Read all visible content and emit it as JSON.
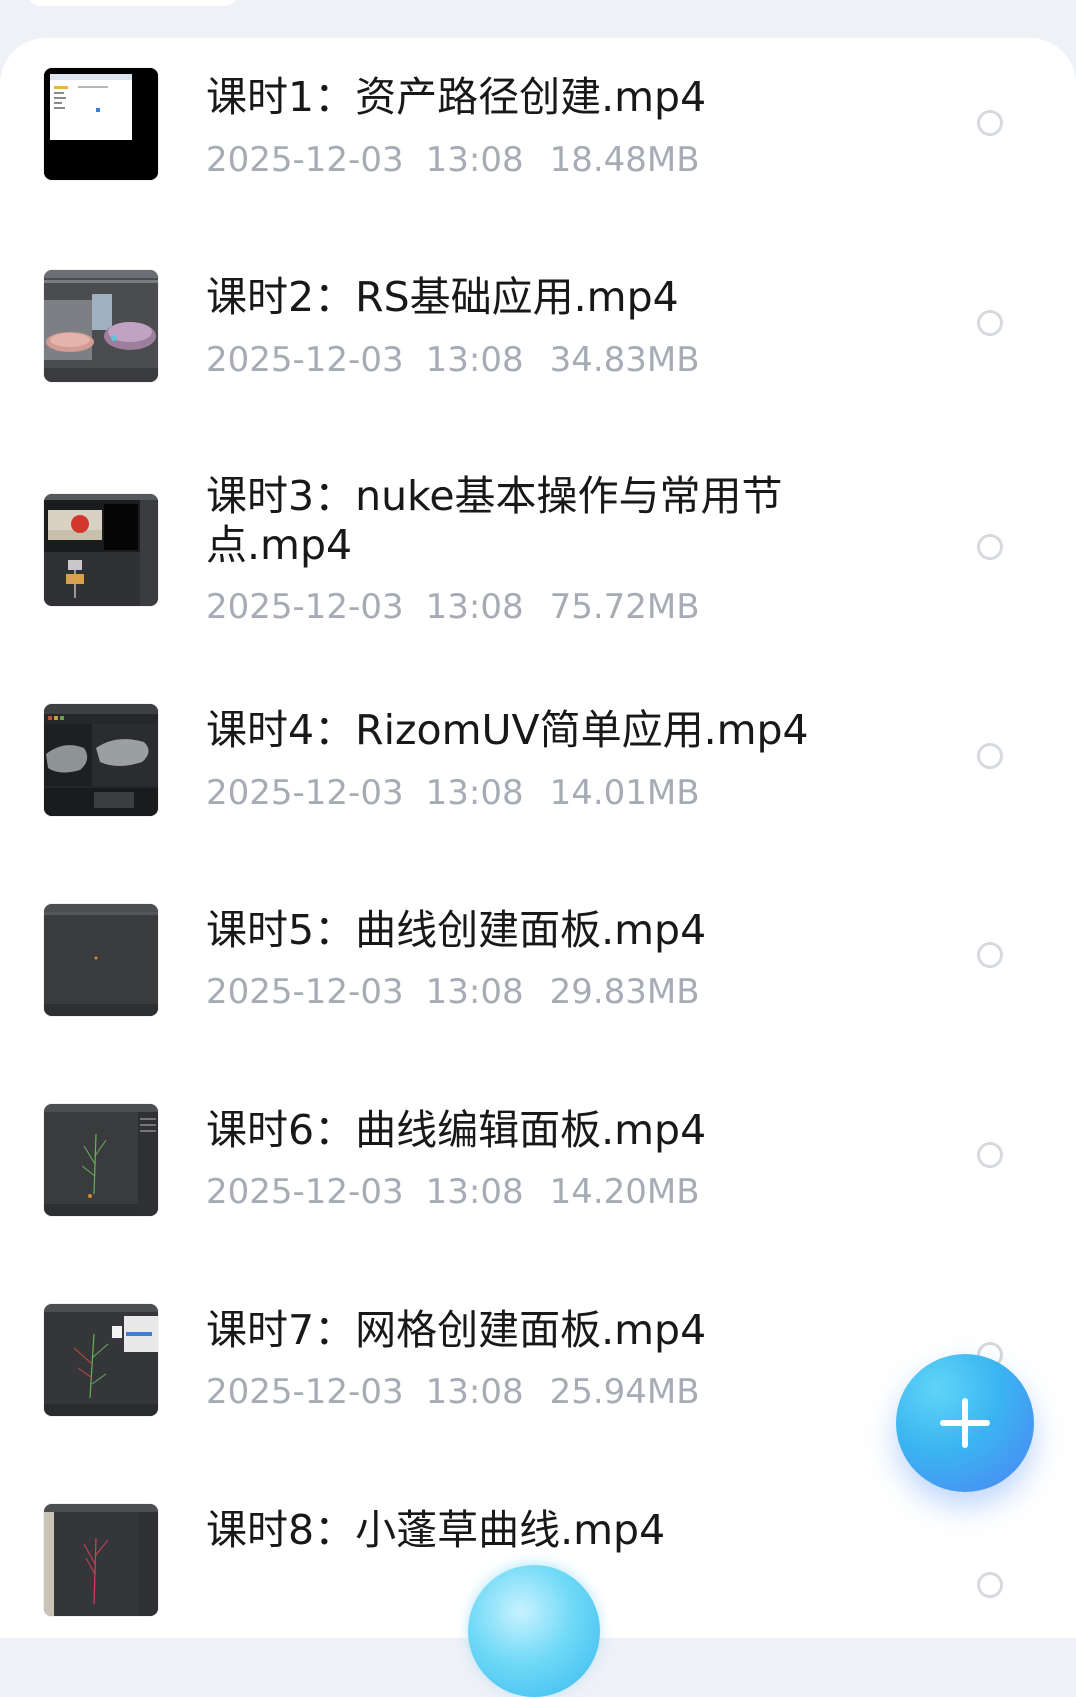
{
  "files": [
    {
      "name": "课时1：资产路径创建.mp4",
      "date": "2025-12-03",
      "time": "13:08",
      "size": "18.48MB",
      "thumb": "white-window-on-black"
    },
    {
      "name": "课时2：RS基础应用.mp4",
      "date": "2025-12-03",
      "time": "13:08",
      "size": "34.83MB",
      "thumb": "3d-viewport-discs"
    },
    {
      "name": "课时3：nuke基本操作与常用节点.mp4",
      "date": "2025-12-03",
      "time": "13:08",
      "size": "75.72MB",
      "thumb": "nuke-node-graph"
    },
    {
      "name": "课时4：RizomUV简单应用.mp4",
      "date": "2025-12-03",
      "time": "13:08",
      "size": "14.01MB",
      "thumb": "uv-mesh-viewport"
    },
    {
      "name": "课时5：曲线创建面板.mp4",
      "date": "2025-12-03",
      "time": "13:08",
      "size": "29.83MB",
      "thumb": "empty-viewport"
    },
    {
      "name": "课时6：曲线编辑面板.mp4",
      "date": "2025-12-03",
      "time": "13:08",
      "size": "14.20MB",
      "thumb": "curve-plant-viewport"
    },
    {
      "name": "课时7：网格创建面板.mp4",
      "date": "2025-12-03",
      "time": "13:08",
      "size": "25.94MB",
      "thumb": "mesh-plant-viewport"
    },
    {
      "name": "课时8：小蓬草曲线.mp4",
      "date": "",
      "time": "",
      "size": "",
      "thumb": "red-plant-viewport"
    }
  ],
  "fab": {
    "icon": "plus-icon",
    "color": "#3aa8f2"
  }
}
